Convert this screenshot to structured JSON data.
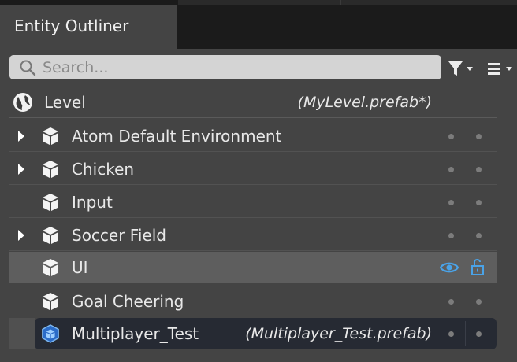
{
  "tab": {
    "title": "Entity Outliner"
  },
  "search": {
    "placeholder": "Search..."
  },
  "toolbar": {
    "filter_icon": "filter-icon",
    "menu_icon": "hamburger-menu-icon"
  },
  "level": {
    "label": "Level",
    "prefab": "(MyLevel.prefab*)",
    "icon": "globe-icon"
  },
  "entities": [
    {
      "label": "Atom Default Environment",
      "expandable": true
    },
    {
      "label": "Chicken",
      "expandable": true
    },
    {
      "label": "Input",
      "expandable": false
    },
    {
      "label": "Soccer Field",
      "expandable": true
    },
    {
      "label": "UI",
      "expandable": false,
      "state": "hovered",
      "visibility_icon": "eye-icon",
      "lock_icon": "unlocked-icon"
    },
    {
      "label": "Goal Cheering",
      "expandable": false
    }
  ],
  "selected_entity": {
    "label": "Multiplayer_Test",
    "prefab": "(Multiplayer_Test.prefab)",
    "icon": "prefab-cube-icon"
  },
  "colors": {
    "panel_bg": "#444444",
    "selected_bg": "#262a33",
    "accent": "#4aa3e8",
    "hover_bg": "#5e5e5e"
  }
}
